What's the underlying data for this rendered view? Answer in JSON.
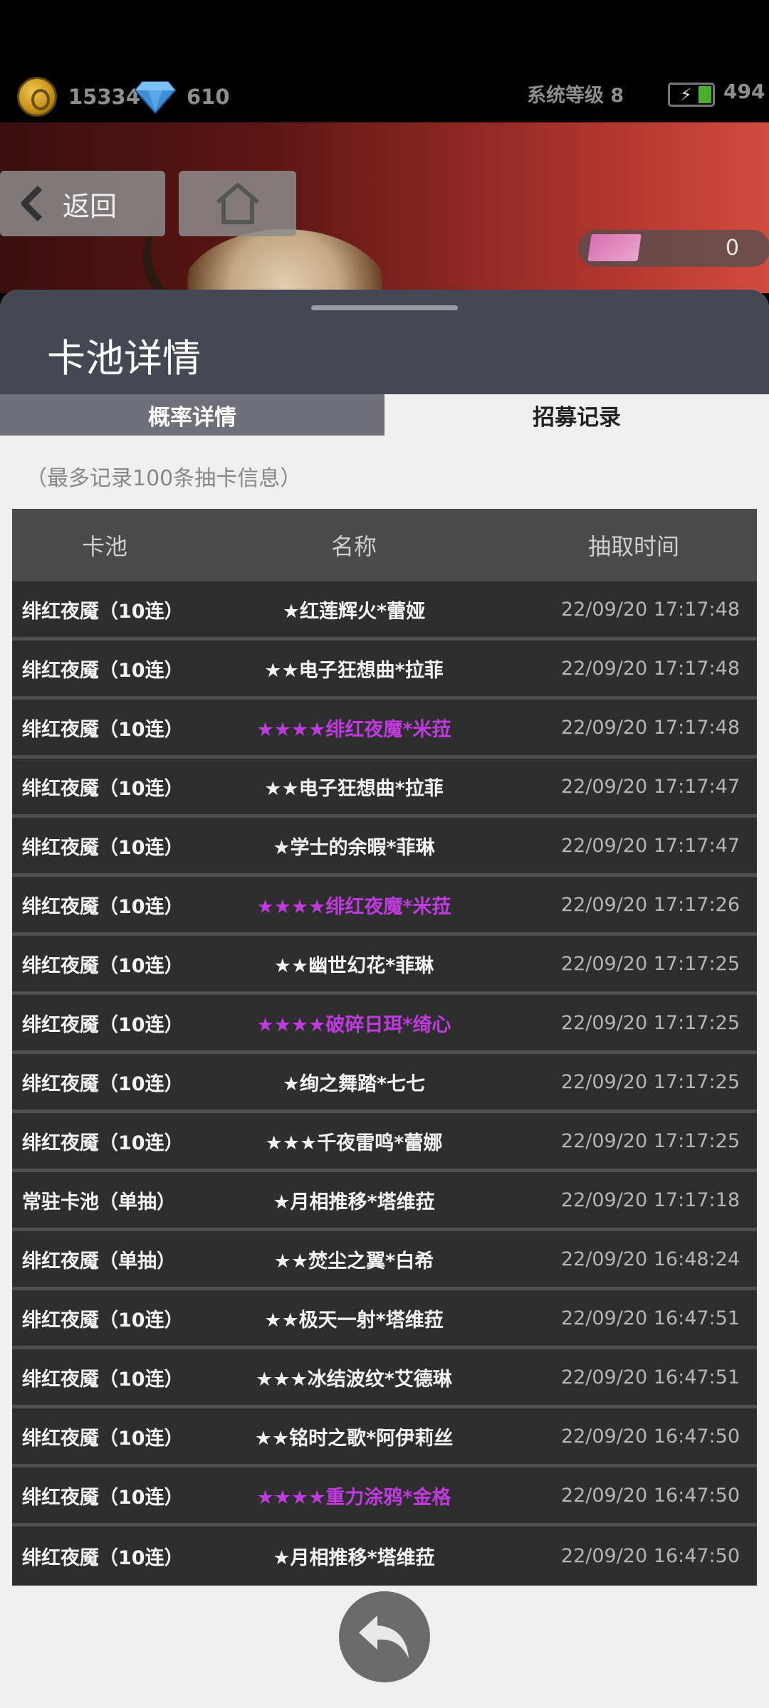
{
  "resources": {
    "coins": "15334",
    "gems": "610",
    "system_level": "系统等级 8",
    "energy": "494"
  },
  "banner": {
    "back_label": "返回",
    "ticket_count": "0"
  },
  "sheet": {
    "title": "卡池详情",
    "tabs": [
      {
        "label": "概率详情",
        "active": false
      },
      {
        "label": "招募记录",
        "active": true
      }
    ],
    "note": "（最多记录100条抽卡信息）"
  },
  "table": {
    "headers": [
      "卡池",
      "名称",
      "抽取时间"
    ],
    "rows": [
      {
        "pool": "绯红夜魇（10连）",
        "name": "★红莲辉火*蕾娅",
        "time": "22/09/20 17:17:48",
        "rarity": 1
      },
      {
        "pool": "绯红夜魇（10连）",
        "name": "★★电子狂想曲*拉菲",
        "time": "22/09/20 17:17:48",
        "rarity": 2
      },
      {
        "pool": "绯红夜魇（10连）",
        "name": "★★★★绯红夜魔*米菈",
        "time": "22/09/20 17:17:48",
        "rarity": 4
      },
      {
        "pool": "绯红夜魇（10连）",
        "name": "★★电子狂想曲*拉菲",
        "time": "22/09/20 17:17:47",
        "rarity": 2
      },
      {
        "pool": "绯红夜魇（10连）",
        "name": "★学士的余暇*菲琳",
        "time": "22/09/20 17:17:47",
        "rarity": 1
      },
      {
        "pool": "绯红夜魇（10连）",
        "name": "★★★★绯红夜魔*米菈",
        "time": "22/09/20 17:17:26",
        "rarity": 4
      },
      {
        "pool": "绯红夜魇（10连）",
        "name": "★★幽世幻花*菲琳",
        "time": "22/09/20 17:17:25",
        "rarity": 2
      },
      {
        "pool": "绯红夜魇（10连）",
        "name": "★★★★破碎日珥*绮心",
        "time": "22/09/20 17:17:25",
        "rarity": 4
      },
      {
        "pool": "绯红夜魇（10连）",
        "name": "★绚之舞踏*七七",
        "time": "22/09/20 17:17:25",
        "rarity": 1
      },
      {
        "pool": "绯红夜魇（10连）",
        "name": "★★★千夜雷鸣*蕾娜",
        "time": "22/09/20 17:17:25",
        "rarity": 3
      },
      {
        "pool": "常驻卡池（单抽）",
        "name": "★月相推移*塔维菈",
        "time": "22/09/20 17:17:18",
        "rarity": 1
      },
      {
        "pool": "绯红夜魇（单抽）",
        "name": "★★焚尘之翼*白希",
        "time": "22/09/20 16:48:24",
        "rarity": 2
      },
      {
        "pool": "绯红夜魇（10连）",
        "name": "★★极天一射*塔维菈",
        "time": "22/09/20 16:47:51",
        "rarity": 2
      },
      {
        "pool": "绯红夜魇（10连）",
        "name": "★★★冰结波纹*艾德琳",
        "time": "22/09/20 16:47:51",
        "rarity": 3
      },
      {
        "pool": "绯红夜魇（10连）",
        "name": "★★铭时之歌*阿伊莉丝",
        "time": "22/09/20 16:47:50",
        "rarity": 2
      },
      {
        "pool": "绯红夜魇（10连）",
        "name": "★★★★重力涂鸦*金格",
        "time": "22/09/20 16:47:50",
        "rarity": 4
      },
      {
        "pool": "绯红夜魇（10连）",
        "name": "★月相推移*塔维菈",
        "time": "22/09/20 16:47:50",
        "rarity": 1
      }
    ]
  },
  "colors": {
    "rarity4": "#c13ae0",
    "normal_name": "#f4f4f4"
  },
  "icons": [
    "coin-icon",
    "gem-icon",
    "battery-icon",
    "chevron-left-icon",
    "home-icon",
    "ticket-icon",
    "return-arrow-icon"
  ]
}
